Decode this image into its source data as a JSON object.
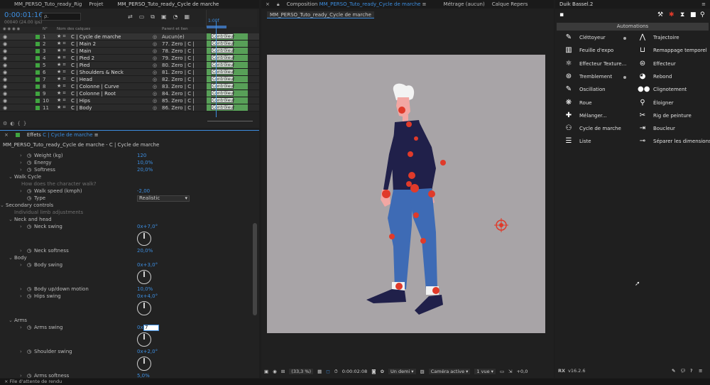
{
  "timeline": {
    "tabs": [
      "MM_PERSO_Tuto_ready_Rig",
      "Projet",
      "MM_PERSO_Tuto_ready_Cycle de marche"
    ],
    "timecode": "0:00:01:16",
    "frames": "00040 (24.00 ips)",
    "search_placeholder": "ρ.",
    "col_num": "N°",
    "col_name": "Nom des calques",
    "col_parent": "Parent et lien",
    "playhead_label": "1:00f",
    "layers": [
      {
        "num": "1",
        "name": "C | Cycle de marche",
        "parent": "Aucun(e)",
        "effect": "Contrôleur"
      },
      {
        "num": "2",
        "name": "C | Main 2",
        "parent": "77. Zero | C |",
        "effect": "Contrôleur"
      },
      {
        "num": "3",
        "name": "C | Main",
        "parent": "78. Zero | C |",
        "effect": "Contrôleur"
      },
      {
        "num": "4",
        "name": "C | Pied 2",
        "parent": "79. Zero | C |",
        "effect": "Contrôleur"
      },
      {
        "num": "5",
        "name": "C | Pied",
        "parent": "80. Zero | C |",
        "effect": "Contrôleur"
      },
      {
        "num": "6",
        "name": "C | Shoulders & Neck",
        "parent": "81. Zero | C |",
        "effect": "Contrôleur"
      },
      {
        "num": "7",
        "name": "C | Head",
        "parent": "82. Zero | C |",
        "effect": "Contrôleur"
      },
      {
        "num": "8",
        "name": "C | Colonne | Curve",
        "parent": "83. Zero | C |",
        "effect": "Contrôleur"
      },
      {
        "num": "9",
        "name": "C | Colonne | Root",
        "parent": "84. Zero | C |",
        "effect": "Contrôleur"
      },
      {
        "num": "10",
        "name": "C | Hips",
        "parent": "85. Zero | C |",
        "effect": "Contrôleur"
      },
      {
        "num": "11",
        "name": "C | Body",
        "parent": "86. Zero | C |",
        "effect": "Contrôleur"
      }
    ]
  },
  "effects": {
    "tab_prefix": "Effets",
    "tab_layer": "C | Cycle de marche",
    "path": "MM_PERSO_Tuto_ready_Cycle de marche - C | Cycle de marche",
    "rows": [
      {
        "label": "Weight (kg)",
        "value": "120"
      },
      {
        "label": "Energy",
        "value": "10,0%"
      },
      {
        "label": "Softness",
        "value": "20,0%"
      },
      {
        "label": "Walk Cycle",
        "value": ""
      },
      {
        "label": "How does the character walk?",
        "value": ""
      },
      {
        "label": "Walk speed (kmph)",
        "value": "-2,00"
      },
      {
        "label": "Type",
        "value": "Realistic"
      },
      {
        "label": "Secondary controls",
        "value": ""
      },
      {
        "label": "Individual limb adjustments",
        "value": ""
      },
      {
        "label": "Neck and head",
        "value": ""
      },
      {
        "label": "Neck swing",
        "value": "0x+7,0°"
      },
      {
        "label": "Neck softness",
        "value": "20,0%"
      },
      {
        "label": "Body",
        "value": ""
      },
      {
        "label": "Body swing",
        "value": "0x+3,0°"
      },
      {
        "label": "Body up/down motion",
        "value": "10,0%"
      },
      {
        "label": "Hips swing",
        "value": "0x+4,0°"
      },
      {
        "label": "Arms",
        "value": ""
      },
      {
        "label": "Arms swing",
        "value": "0x"
      },
      {
        "label": "Arms swing input",
        "value": "7"
      },
      {
        "label": "Shoulder swing",
        "value": "0x+2,0°"
      },
      {
        "label": "Arms softness",
        "value": "5,0%"
      }
    ]
  },
  "composition": {
    "tab_prefix": "Composition",
    "tab_name": "MM_PERSO_Tuto_ready_Cycle de marche",
    "tab_metrage": "Métrage  (aucun)",
    "tab_calque": "Calque  Repers",
    "subtab": "MM_PERSO_Tuto_ready_Cycle de marche",
    "bg_color": "#a8a4a7",
    "zoom": "(33,3 %)",
    "time": "0:00:02:08",
    "resolution": "Un demi",
    "camera": "Caméra active",
    "views": "1 vue",
    "plus": "+0,0"
  },
  "duik": {
    "title": "Duik Bassel.2",
    "section": "Automations",
    "version": "v16.2.6",
    "items_left": [
      "Cléttoyeur",
      "Feuille d'expo",
      "Effecteur Texture...",
      "Tremblement",
      "Oscillation",
      "Roue",
      "Mélanger...",
      "Cycle de marche",
      "Liste"
    ],
    "items_right": [
      "Trajectoire",
      "Remappage temporel",
      "Effecteur",
      "Rebond",
      "Clignotement",
      "Éloigner",
      "Rig de peinture",
      "Boucleur",
      "Séparer les dimensions"
    ]
  },
  "footer": {
    "status": "File d'attente de rendu"
  },
  "colors": {
    "accent": "#3d8ee0",
    "layer_green": "#58a058",
    "controller_red": "#e03a2a"
  }
}
